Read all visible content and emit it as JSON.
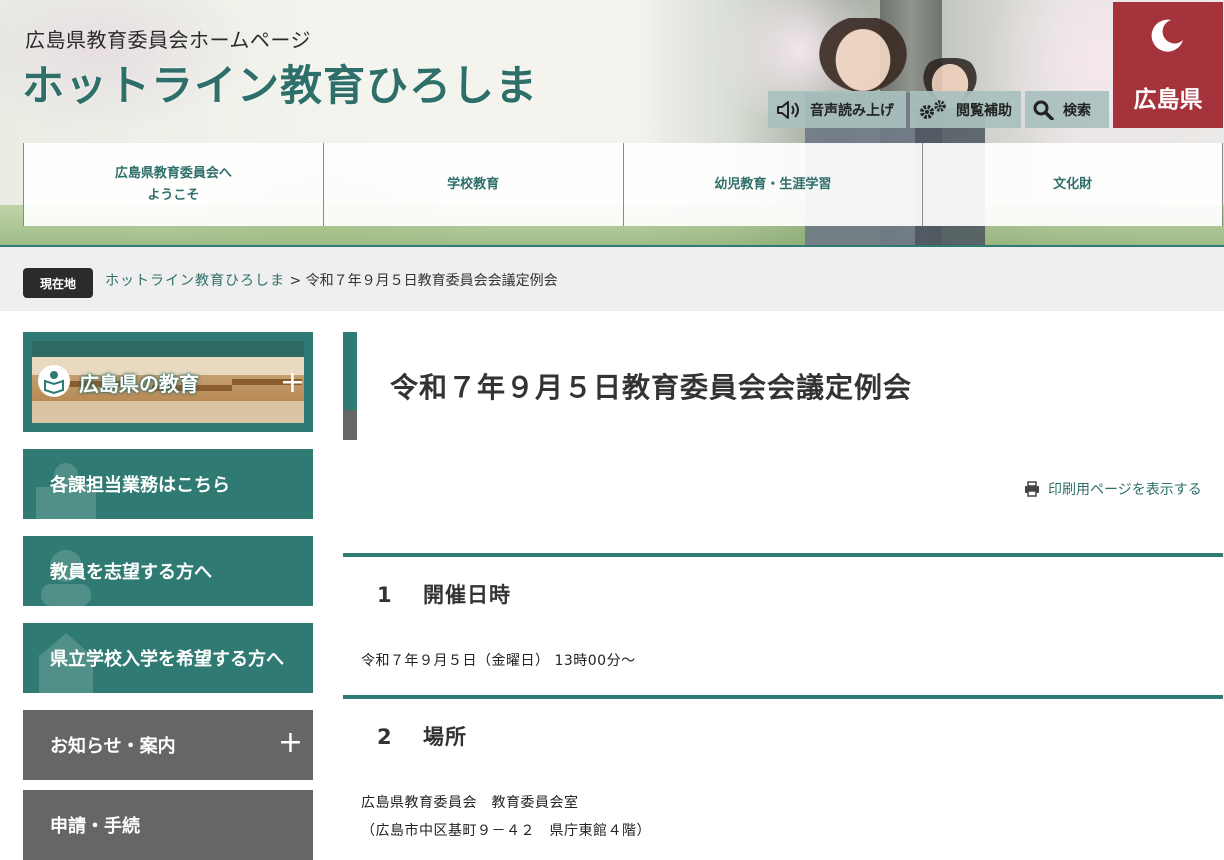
{
  "header": {
    "subtitle": "広島県教育委員会ホームページ",
    "site_title": "ホットライン教育ひろしま",
    "pref_logo_text": "広島県",
    "utilities": [
      {
        "label": "音声読み上げ",
        "icon": "speaker-icon"
      },
      {
        "label": "閲覧補助",
        "icon": "gear-icon"
      },
      {
        "label": "検索",
        "icon": "search-icon"
      }
    ],
    "nav": [
      {
        "line1": "広島県教育委員会へ",
        "line2": "ようこそ"
      },
      {
        "label": "学校教育"
      },
      {
        "label": "幼児教育・生涯学習"
      },
      {
        "label": "文化財"
      }
    ]
  },
  "breadcrumb": {
    "label": "現在地",
    "home": "ホットライン教育ひろしま",
    "separator": ">",
    "current": "令和７年９月５日教育委員会会議定例会"
  },
  "sidebar": {
    "banner_label": "広島県の教育",
    "buttons": [
      "各課担当業務はこちら",
      "教員を志望する方へ",
      "県立学校入学を希望する方へ",
      "お知らせ・案内",
      "申請・手続"
    ]
  },
  "main": {
    "title": "令和７年９月５日教育委員会会議定例会",
    "print_link": "印刷用ページを表示する",
    "sections": [
      {
        "num": "1",
        "heading": "開催日時",
        "lines": [
          "令和７年９月５日（金曜日） 13時00分～"
        ]
      },
      {
        "num": "2",
        "heading": "場所",
        "lines": [
          "広島県教育委員会　教育委員会室",
          "（広島市中区基町９－４２　県庁東館４階）"
        ]
      }
    ]
  },
  "colors": {
    "teal": "#2f7b73",
    "gray": "#666666",
    "pref_red": "#a5333c"
  }
}
